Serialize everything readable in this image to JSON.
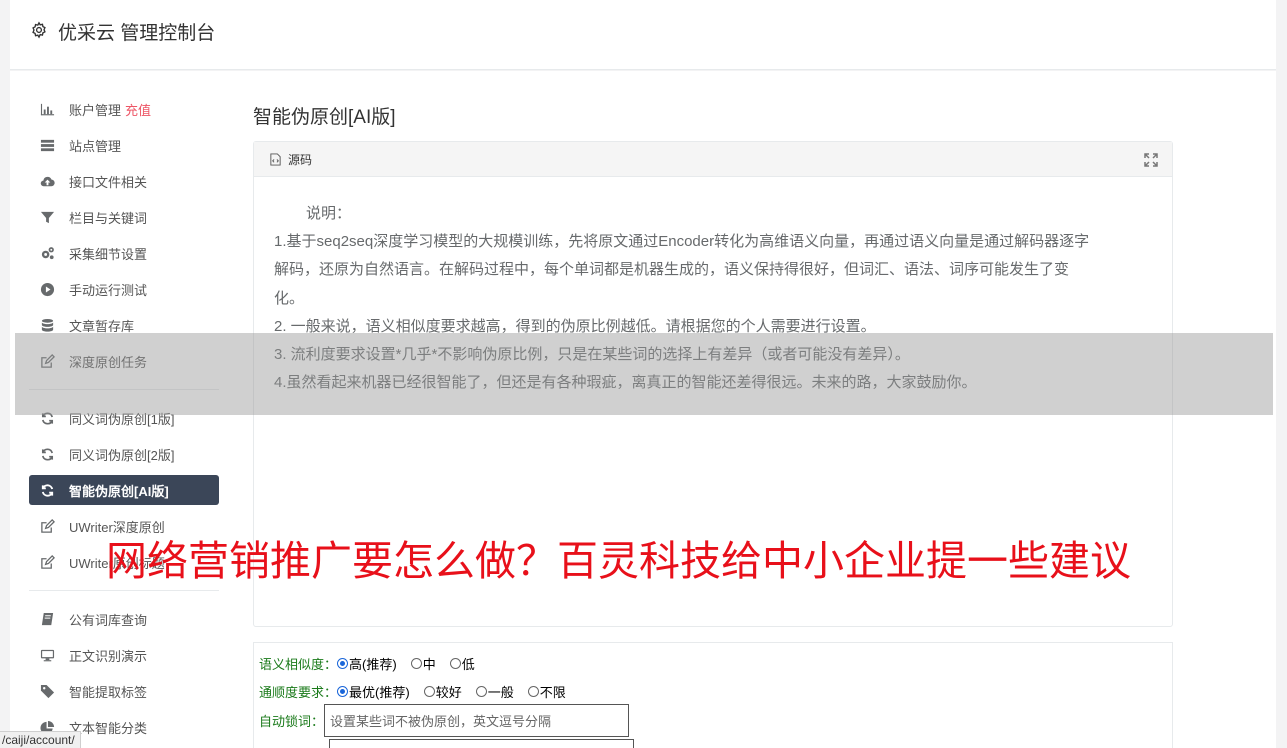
{
  "header": {
    "title": "优采云 管理控制台",
    "icon": "gear-icon"
  },
  "sidebar": {
    "group1": [
      {
        "icon": "bar-chart-icon",
        "label": "账户管理",
        "badge": "充值"
      },
      {
        "icon": "server-list-icon",
        "label": "站点管理"
      },
      {
        "icon": "cloud-upload-icon",
        "label": "接口文件相关"
      },
      {
        "icon": "filter-icon",
        "label": "栏目与关键词"
      },
      {
        "icon": "cogs-icon",
        "label": "采集细节设置"
      },
      {
        "icon": "play-circle-icon",
        "label": "手动运行测试"
      },
      {
        "icon": "database-icon",
        "label": "文章暂存库"
      },
      {
        "icon": "edit-icon",
        "label": "深度原创任务"
      }
    ],
    "group2": [
      {
        "icon": "refresh-icon",
        "label": "同义词伪原创[1版]"
      },
      {
        "icon": "refresh-icon",
        "label": "同义词伪原创[2版]"
      },
      {
        "icon": "refresh-icon",
        "label": "智能伪原创[AI版]"
      },
      {
        "icon": "edit-icon",
        "label": "UWriter深度原创"
      },
      {
        "icon": "edit-icon",
        "label": "UWriter原创标题"
      }
    ],
    "group3": [
      {
        "icon": "book-icon",
        "label": "公有词库查询"
      },
      {
        "icon": "monitor-icon",
        "label": "正文识别演示"
      },
      {
        "icon": "tag-icon",
        "label": "智能提取标签"
      },
      {
        "icon": "pie-chart-icon",
        "label": "文本智能分类"
      }
    ]
  },
  "content": {
    "title": "智能伪原创[AI版]",
    "panel": {
      "head_label": "源码",
      "lead": "说明：",
      "lines": [
        "1.基于seq2seq深度学习模型的大规模训练，先将原文通过Encoder转化为高维语义向量，再通过语义向量是通过解码器逐字",
        "解码，还原为自然语言。在解码过程中，每个单词都是机器生成的，语义保持得很好，但词汇、语法、词序可能发生了变",
        "化。",
        "2. 一般来说，语义相似度要求越高，得到的伪原比例越低。请根据您的个人需要进行设置。",
        "3. 流利度要求设置*几乎*不影响伪原比例，只是在某些词的选择上有差异（或者可能没有差异）。",
        "4.虽然看起来机器已经很智能了，但还是有各种瑕疵，离真正的智能还差得很远。未来的路，大家鼓励你。"
      ]
    },
    "form": {
      "similarity_label": "语义相似度：",
      "similarity_options": [
        "高(推荐)",
        "中",
        "低"
      ],
      "fluency_label": "通顺度要求：",
      "fluency_options": [
        "最优(推荐)",
        "较好",
        "一般",
        "不限"
      ],
      "lock_label": "自动锁词：",
      "lock_placeholder": "设置某些词不被伪原创，英文逗号分隔"
    }
  },
  "watermark": "网络营销推广要怎么做？百灵科技给中小企业提一些建议",
  "status_url": "/caiji/account/"
}
